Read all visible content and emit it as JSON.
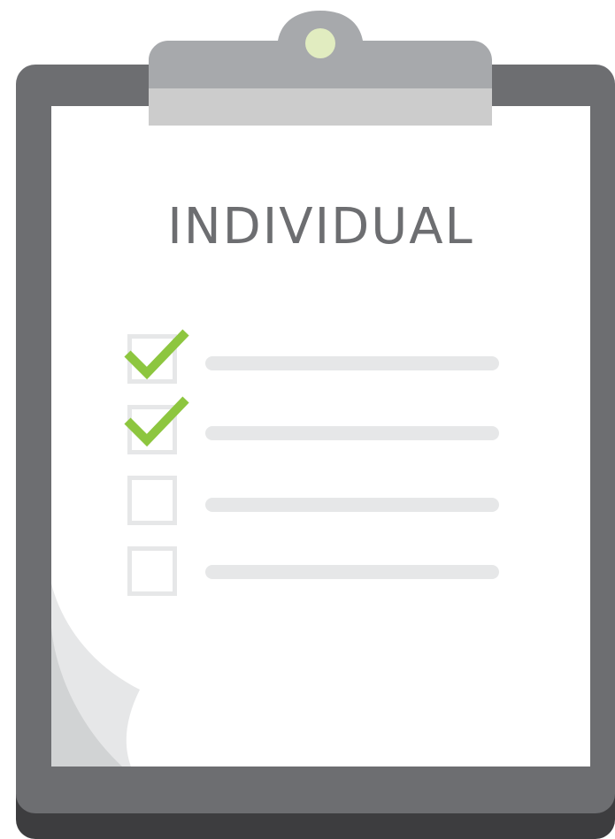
{
  "title": "INDIVIDUAL",
  "checklist": {
    "items": [
      {
        "checked": true
      },
      {
        "checked": true
      },
      {
        "checked": false
      },
      {
        "checked": false
      }
    ]
  },
  "colors": {
    "board": "#6d6e71",
    "board_shadow": "#3d3d3f",
    "paper": "#ffffff",
    "title_text": "#6d6e71",
    "placeholder_line": "#e6e7e8",
    "checkbox_border": "#e6e7e8",
    "checkmark": "#8dc63f",
    "clip_top": "#a7a9ac",
    "clip_bottom": "#cccccc",
    "clip_button": "#e1ecc0",
    "page_curl": "#d1d3d4"
  },
  "icons": {
    "clip": "clipboard-clip-icon",
    "check": "checkmark-icon"
  }
}
